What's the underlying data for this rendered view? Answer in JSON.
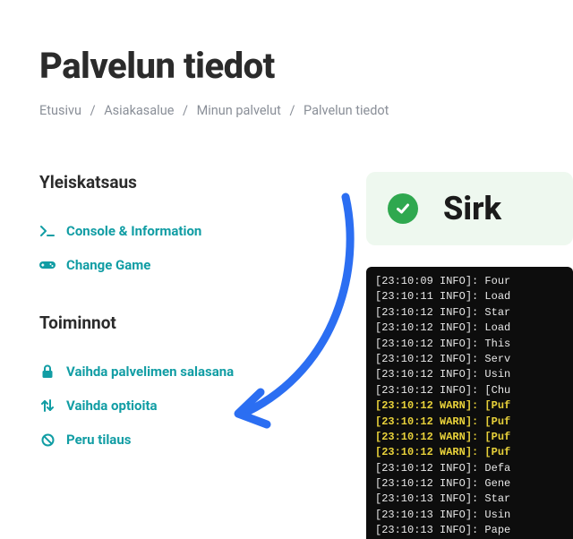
{
  "page": {
    "title": "Palvelun tiedot"
  },
  "breadcrumb": {
    "items": [
      "Etusivu",
      "Asiakasalue",
      "Minun palvelut",
      "Palvelun tiedot"
    ]
  },
  "sidebar": {
    "overview": {
      "heading": "Yleiskatsaus",
      "items": [
        {
          "label": "Console & Information"
        },
        {
          "label": "Change Game"
        }
      ]
    },
    "actions": {
      "heading": "Toiminnot",
      "items": [
        {
          "label": "Vaihda palvelimen salasana"
        },
        {
          "label": "Vaihda optioita"
        },
        {
          "label": "Peru tilaus"
        }
      ]
    }
  },
  "server": {
    "name": "Sirk",
    "status": "ok"
  },
  "console": {
    "lines": [
      {
        "ts": "23:10:09",
        "level": "INFO",
        "msg": "Four"
      },
      {
        "ts": "23:10:11",
        "level": "INFO",
        "msg": "Load"
      },
      {
        "ts": "23:10:12",
        "level": "INFO",
        "msg": "Star"
      },
      {
        "ts": "23:10:12",
        "level": "INFO",
        "msg": "Load"
      },
      {
        "ts": "23:10:12",
        "level": "INFO",
        "msg": "This"
      },
      {
        "ts": "23:10:12",
        "level": "INFO",
        "msg": "Serv"
      },
      {
        "ts": "23:10:12",
        "level": "INFO",
        "msg": "Usin"
      },
      {
        "ts": "23:10:12",
        "level": "INFO",
        "msg": "[Chu"
      },
      {
        "ts": "23:10:12",
        "level": "WARN",
        "msg": "[Puf"
      },
      {
        "ts": "23:10:12",
        "level": "WARN",
        "msg": "[Puf"
      },
      {
        "ts": "23:10:12",
        "level": "WARN",
        "msg": "[Puf"
      },
      {
        "ts": "23:10:12",
        "level": "WARN",
        "msg": "[Puf"
      },
      {
        "ts": "23:10:12",
        "level": "INFO",
        "msg": "Defa"
      },
      {
        "ts": "23:10:12",
        "level": "INFO",
        "msg": "Gene"
      },
      {
        "ts": "23:10:13",
        "level": "INFO",
        "msg": "Star"
      },
      {
        "ts": "23:10:13",
        "level": "INFO",
        "msg": "Usin"
      },
      {
        "ts": "23:10:13",
        "level": "INFO",
        "msg": "Pape"
      }
    ]
  },
  "colors": {
    "accent": "#119da4",
    "ok_green": "#2fa84f",
    "ok_bg": "#eef8ef",
    "warn": "#e8d13a",
    "arrow": "#2b6ef2"
  }
}
